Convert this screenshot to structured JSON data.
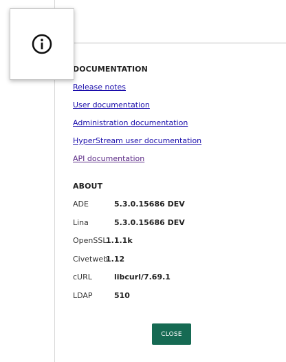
{
  "icons": {
    "info": "info-circle-icon"
  },
  "colors": {
    "link": "#1a0dab",
    "link_visited": "#5b2a86",
    "button_bg": "#166a53",
    "button_text": "#ffffff"
  },
  "documentation": {
    "title": "DOCUMENTATION",
    "links": [
      {
        "label": "Release notes"
      },
      {
        "label": "User documentation"
      },
      {
        "label": "Administration documentation"
      },
      {
        "label": "HyperStream user documentation"
      },
      {
        "label": "API documentation"
      }
    ]
  },
  "about": {
    "title": "ABOUT",
    "rows": [
      {
        "key": "ADE",
        "value": "5.3.0.15686 DEV"
      },
      {
        "key": "Lina",
        "value": "5.3.0.15686 DEV"
      },
      {
        "key": "OpenSSL",
        "value": "1.1.1k"
      },
      {
        "key": "Civetweb",
        "value": "1.12"
      },
      {
        "key": "cURL",
        "value": "libcurl/7.69.1"
      },
      {
        "key": "LDAP",
        "value": "510"
      }
    ]
  },
  "actions": {
    "close_label": "CLOSE"
  }
}
